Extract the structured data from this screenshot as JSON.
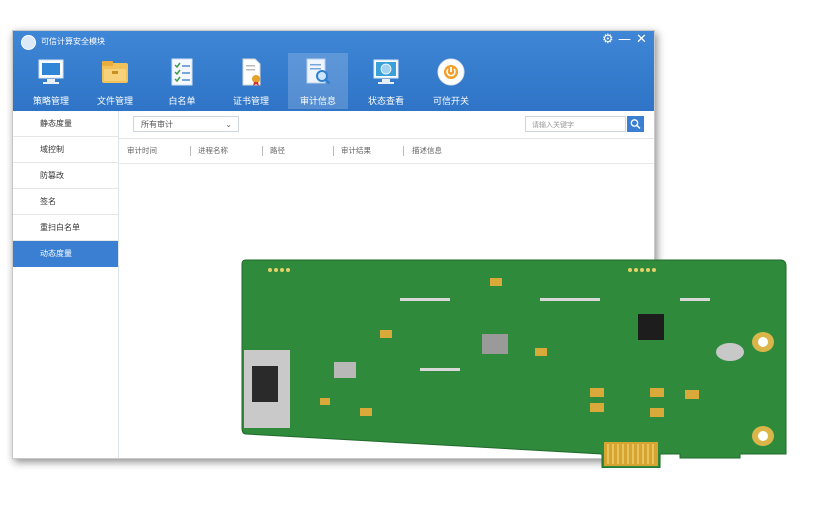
{
  "window": {
    "title": "可信计算安全模块",
    "controls": {
      "settings": "⚙",
      "minimize": "—",
      "close": "✕"
    }
  },
  "toolbar": {
    "items": [
      {
        "label": "策略管理",
        "icon": "monitor-icon"
      },
      {
        "label": "文件管理",
        "icon": "folder-icon"
      },
      {
        "label": "白名单",
        "icon": "checklist-icon"
      },
      {
        "label": "证书管理",
        "icon": "certificate-icon"
      },
      {
        "label": "审计信息",
        "icon": "audit-search-icon",
        "active": true
      },
      {
        "label": "状态查看",
        "icon": "globe-monitor-icon"
      },
      {
        "label": "可信开关",
        "icon": "power-icon"
      }
    ]
  },
  "sidebar": {
    "items": [
      {
        "label": "静态度量"
      },
      {
        "label": "域控制"
      },
      {
        "label": "防篡改"
      },
      {
        "label": "签名"
      },
      {
        "label": "重扫白名单"
      },
      {
        "label": "动态度量",
        "active": true
      }
    ]
  },
  "filters": {
    "audit_select": "所有审计",
    "search_placeholder": "请输入关键字"
  },
  "table": {
    "columns": [
      "审计时间",
      "进程名称",
      "路径",
      "审计结果",
      "描述信息"
    ]
  },
  "colors": {
    "accent": "#3a7fd1",
    "topbar": "#3a80d2",
    "pcb": "#2e8b3a"
  }
}
